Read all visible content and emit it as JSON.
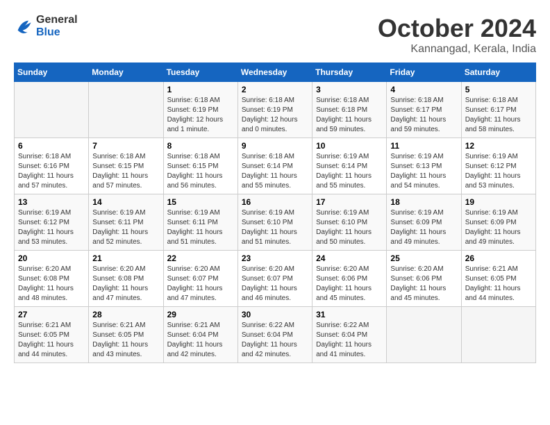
{
  "header": {
    "logo_general": "General",
    "logo_blue": "Blue",
    "month_title": "October 2024",
    "location": "Kannangad, Kerala, India"
  },
  "weekdays": [
    "Sunday",
    "Monday",
    "Tuesday",
    "Wednesday",
    "Thursday",
    "Friday",
    "Saturday"
  ],
  "weeks": [
    [
      {
        "day": "",
        "info": ""
      },
      {
        "day": "",
        "info": ""
      },
      {
        "day": "1",
        "info": "Sunrise: 6:18 AM\nSunset: 6:19 PM\nDaylight: 12 hours\nand 1 minute."
      },
      {
        "day": "2",
        "info": "Sunrise: 6:18 AM\nSunset: 6:19 PM\nDaylight: 12 hours\nand 0 minutes."
      },
      {
        "day": "3",
        "info": "Sunrise: 6:18 AM\nSunset: 6:18 PM\nDaylight: 11 hours\nand 59 minutes."
      },
      {
        "day": "4",
        "info": "Sunrise: 6:18 AM\nSunset: 6:17 PM\nDaylight: 11 hours\nand 59 minutes."
      },
      {
        "day": "5",
        "info": "Sunrise: 6:18 AM\nSunset: 6:17 PM\nDaylight: 11 hours\nand 58 minutes."
      }
    ],
    [
      {
        "day": "6",
        "info": "Sunrise: 6:18 AM\nSunset: 6:16 PM\nDaylight: 11 hours\nand 57 minutes."
      },
      {
        "day": "7",
        "info": "Sunrise: 6:18 AM\nSunset: 6:15 PM\nDaylight: 11 hours\nand 57 minutes."
      },
      {
        "day": "8",
        "info": "Sunrise: 6:18 AM\nSunset: 6:15 PM\nDaylight: 11 hours\nand 56 minutes."
      },
      {
        "day": "9",
        "info": "Sunrise: 6:18 AM\nSunset: 6:14 PM\nDaylight: 11 hours\nand 55 minutes."
      },
      {
        "day": "10",
        "info": "Sunrise: 6:19 AM\nSunset: 6:14 PM\nDaylight: 11 hours\nand 55 minutes."
      },
      {
        "day": "11",
        "info": "Sunrise: 6:19 AM\nSunset: 6:13 PM\nDaylight: 11 hours\nand 54 minutes."
      },
      {
        "day": "12",
        "info": "Sunrise: 6:19 AM\nSunset: 6:12 PM\nDaylight: 11 hours\nand 53 minutes."
      }
    ],
    [
      {
        "day": "13",
        "info": "Sunrise: 6:19 AM\nSunset: 6:12 PM\nDaylight: 11 hours\nand 53 minutes."
      },
      {
        "day": "14",
        "info": "Sunrise: 6:19 AM\nSunset: 6:11 PM\nDaylight: 11 hours\nand 52 minutes."
      },
      {
        "day": "15",
        "info": "Sunrise: 6:19 AM\nSunset: 6:11 PM\nDaylight: 11 hours\nand 51 minutes."
      },
      {
        "day": "16",
        "info": "Sunrise: 6:19 AM\nSunset: 6:10 PM\nDaylight: 11 hours\nand 51 minutes."
      },
      {
        "day": "17",
        "info": "Sunrise: 6:19 AM\nSunset: 6:10 PM\nDaylight: 11 hours\nand 50 minutes."
      },
      {
        "day": "18",
        "info": "Sunrise: 6:19 AM\nSunset: 6:09 PM\nDaylight: 11 hours\nand 49 minutes."
      },
      {
        "day": "19",
        "info": "Sunrise: 6:19 AM\nSunset: 6:09 PM\nDaylight: 11 hours\nand 49 minutes."
      }
    ],
    [
      {
        "day": "20",
        "info": "Sunrise: 6:20 AM\nSunset: 6:08 PM\nDaylight: 11 hours\nand 48 minutes."
      },
      {
        "day": "21",
        "info": "Sunrise: 6:20 AM\nSunset: 6:08 PM\nDaylight: 11 hours\nand 47 minutes."
      },
      {
        "day": "22",
        "info": "Sunrise: 6:20 AM\nSunset: 6:07 PM\nDaylight: 11 hours\nand 47 minutes."
      },
      {
        "day": "23",
        "info": "Sunrise: 6:20 AM\nSunset: 6:07 PM\nDaylight: 11 hours\nand 46 minutes."
      },
      {
        "day": "24",
        "info": "Sunrise: 6:20 AM\nSunset: 6:06 PM\nDaylight: 11 hours\nand 45 minutes."
      },
      {
        "day": "25",
        "info": "Sunrise: 6:20 AM\nSunset: 6:06 PM\nDaylight: 11 hours\nand 45 minutes."
      },
      {
        "day": "26",
        "info": "Sunrise: 6:21 AM\nSunset: 6:05 PM\nDaylight: 11 hours\nand 44 minutes."
      }
    ],
    [
      {
        "day": "27",
        "info": "Sunrise: 6:21 AM\nSunset: 6:05 PM\nDaylight: 11 hours\nand 44 minutes."
      },
      {
        "day": "28",
        "info": "Sunrise: 6:21 AM\nSunset: 6:05 PM\nDaylight: 11 hours\nand 43 minutes."
      },
      {
        "day": "29",
        "info": "Sunrise: 6:21 AM\nSunset: 6:04 PM\nDaylight: 11 hours\nand 42 minutes."
      },
      {
        "day": "30",
        "info": "Sunrise: 6:22 AM\nSunset: 6:04 PM\nDaylight: 11 hours\nand 42 minutes."
      },
      {
        "day": "31",
        "info": "Sunrise: 6:22 AM\nSunset: 6:04 PM\nDaylight: 11 hours\nand 41 minutes."
      },
      {
        "day": "",
        "info": ""
      },
      {
        "day": "",
        "info": ""
      }
    ]
  ]
}
